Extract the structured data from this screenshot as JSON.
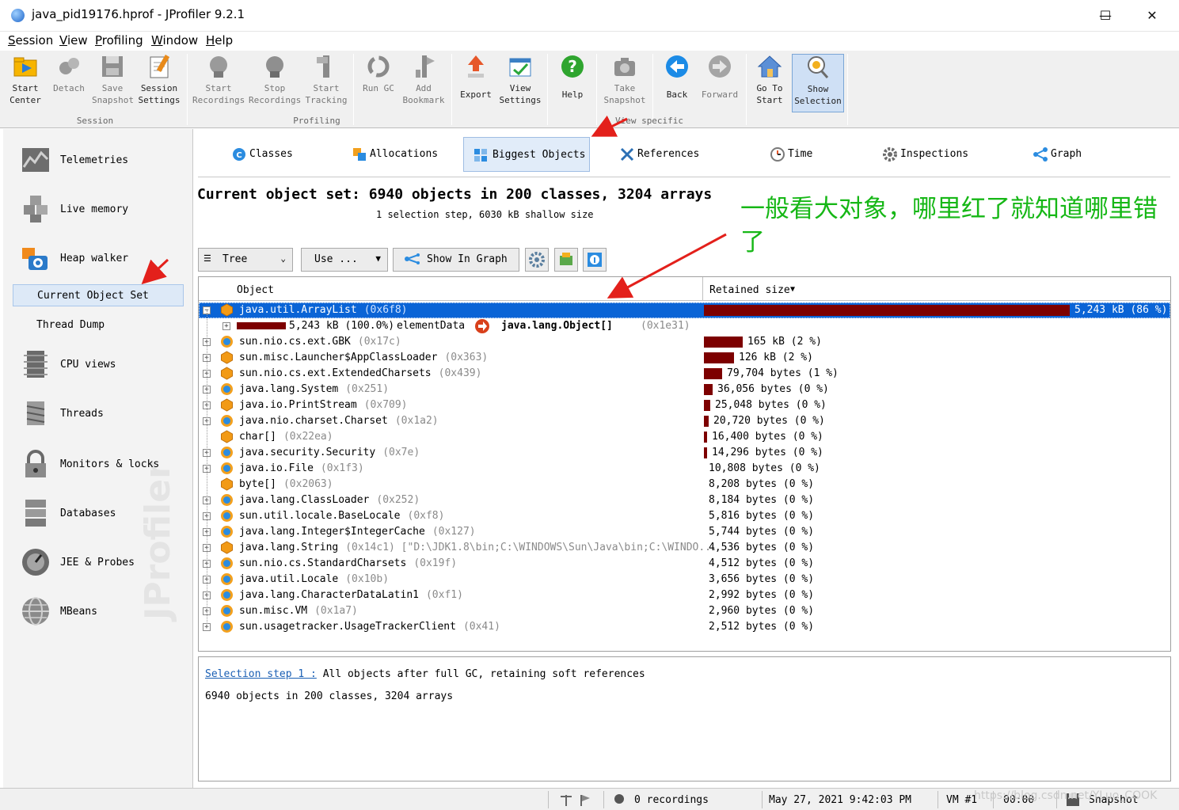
{
  "window": {
    "title": "java_pid19176.hprof - JProfiler 9.2.1",
    "minimize": "—",
    "maximize": "☐",
    "close": "✕"
  },
  "menu": [
    "Session",
    "View",
    "Profiling",
    "Window",
    "Help"
  ],
  "toolbar": {
    "buttons": [
      {
        "label": "Start\nCenter",
        "icon": "folder-start-icon"
      },
      {
        "label": "Detach",
        "icon": "detach-icon"
      },
      {
        "label": "Save\nSnapshot",
        "icon": "save-icon"
      },
      {
        "label": "Session\nSettings",
        "icon": "session-settings-icon"
      },
      {
        "label": "Start\nRecordings",
        "icon": "start-recordings-icon"
      },
      {
        "label": "Stop\nRecordings",
        "icon": "stop-recordings-icon"
      },
      {
        "label": "Start\nTracking",
        "icon": "start-tracking-icon"
      },
      {
        "label": "Run GC",
        "icon": "run-gc-icon"
      },
      {
        "label": "Add\nBookmark",
        "icon": "bookmark-icon"
      },
      {
        "label": "Export",
        "icon": "export-icon"
      },
      {
        "label": "View\nSettings",
        "icon": "view-settings-icon"
      },
      {
        "label": "Help",
        "icon": "help-icon"
      },
      {
        "label": "Take\nSnapshot",
        "icon": "camera-icon"
      },
      {
        "label": "Back",
        "icon": "back-arrow-icon"
      },
      {
        "label": "Forward",
        "icon": "forward-arrow-icon"
      },
      {
        "label": "Go To\nStart",
        "icon": "home-icon"
      },
      {
        "label": "Show\nSelection",
        "icon": "show-selection-icon"
      }
    ],
    "groups": {
      "session": "Session",
      "profiling": "Profiling",
      "view_specific": "View specific"
    }
  },
  "sidebar": {
    "items": [
      {
        "label": "Telemetries",
        "icon": "telemetries-icon"
      },
      {
        "label": "Live memory",
        "icon": "live-memory-icon"
      },
      {
        "label": "Heap walker",
        "icon": "heap-walker-icon"
      },
      {
        "label": "CPU views",
        "icon": "cpu-views-icon"
      },
      {
        "label": "Threads",
        "icon": "threads-icon"
      },
      {
        "label": "Monitors & locks",
        "icon": "monitors-lock-icon"
      },
      {
        "label": "Databases",
        "icon": "databases-icon"
      },
      {
        "label": "JEE & Probes",
        "icon": "jee-probes-icon"
      },
      {
        "label": "MBeans",
        "icon": "mbeans-icon"
      }
    ],
    "sub_items": [
      "Current Object Set",
      "Thread Dump"
    ],
    "watermark": "JProfiler"
  },
  "view_tabs": [
    "Classes",
    "Allocations",
    "Biggest Objects",
    "References",
    "Time",
    "Inspections",
    "Graph"
  ],
  "object_set": {
    "title": "Current object set: 6940 objects in 200 classes, 3204 arrays",
    "subtitle": "1 selection step, 6030 kB shallow size"
  },
  "annotation": "一般看大对象，哪里红了就知道哪里错了",
  "controls": {
    "view_mode": "Tree",
    "use": "Use ...",
    "show_in_graph": "Show In Graph"
  },
  "table": {
    "col_object": "Object",
    "col_retained": "Retained size",
    "sort_arrow": "▼",
    "rows": [
      {
        "name": "java.util.ArrayList",
        "id": "(0x6f8)",
        "retained": "5,243 kB (86 %)",
        "pct": 0.86,
        "icon": "instance-orange-icon",
        "expand": "−"
      },
      {
        "name": "",
        "id": "(0x1e31)",
        "retained": "",
        "pct": 0,
        "icon": "",
        "expand": "+",
        "ref_size": "5,243 kB (100.0%)",
        "ref_field": "elementData",
        "ref_target": "java.lang.Object[]"
      },
      {
        "name": "sun.nio.cs.ext.GBK",
        "id": "(0x17c)",
        "retained": "165 kB (2 %)",
        "pct": 0.023,
        "icon": "class-blue-icon",
        "expand": "+"
      },
      {
        "name": "sun.misc.Launcher$AppClassLoader",
        "id": "(0x363)",
        "retained": "126 kB (2 %)",
        "pct": 0.018,
        "icon": "instance-orange-icon",
        "expand": "+"
      },
      {
        "name": "sun.nio.cs.ext.ExtendedCharsets",
        "id": "(0x439)",
        "retained": "79,704 bytes (1 %)",
        "pct": 0.011,
        "icon": "instance-orange-icon",
        "expand": "+"
      },
      {
        "name": "java.lang.System",
        "id": "(0x251)",
        "retained": "36,056 bytes (0 %)",
        "pct": 0.005,
        "icon": "class-blue-icon",
        "expand": "+"
      },
      {
        "name": "java.io.PrintStream",
        "id": "(0x709)",
        "retained": "25,048 bytes (0 %)",
        "pct": 0.004,
        "icon": "instance-orange-icon",
        "expand": "+"
      },
      {
        "name": "java.nio.charset.Charset",
        "id": "(0x1a2)",
        "retained": "20,720 bytes (0 %)",
        "pct": 0.003,
        "icon": "class-blue-icon",
        "expand": "+"
      },
      {
        "name": "char[]",
        "id": "(0x22ea)",
        "retained": "16,400 bytes (0 %)",
        "pct": 0.002,
        "icon": "instance-orange-icon",
        "expand": ""
      },
      {
        "name": "java.security.Security",
        "id": "(0x7e)",
        "retained": "14,296 bytes (0 %)",
        "pct": 0.002,
        "icon": "class-blue-icon",
        "expand": "+"
      },
      {
        "name": "java.io.File",
        "id": "(0x1f3)",
        "retained": "10,808 bytes (0 %)",
        "pct": 0,
        "icon": "class-blue-icon",
        "expand": "+"
      },
      {
        "name": "byte[]",
        "id": "(0x2063)",
        "retained": "8,208 bytes (0 %)",
        "pct": 0,
        "icon": "instance-orange-icon",
        "expand": ""
      },
      {
        "name": "java.lang.ClassLoader",
        "id": "(0x252)",
        "retained": "8,184 bytes (0 %)",
        "pct": 0,
        "icon": "class-blue-icon",
        "expand": "+"
      },
      {
        "name": "sun.util.locale.BaseLocale",
        "id": "(0xf8)",
        "retained": "5,816 bytes (0 %)",
        "pct": 0,
        "icon": "class-blue-icon",
        "expand": "+"
      },
      {
        "name": "java.lang.Integer$IntegerCache",
        "id": "(0x127)",
        "retained": "5,744 bytes (0 %)",
        "pct": 0,
        "icon": "class-blue-icon",
        "expand": "+"
      },
      {
        "name": "java.lang.String",
        "id": "(0x14c1) [\"D:\\JDK1.8\\bin;C:\\WINDOWS\\Sun\\Java\\bin;C:\\WINDO...",
        "retained": "4,536 bytes (0 %)",
        "pct": 0,
        "icon": "instance-orange-icon",
        "expand": "+"
      },
      {
        "name": "sun.nio.cs.StandardCharsets",
        "id": "(0x19f)",
        "retained": "4,512 bytes (0 %)",
        "pct": 0,
        "icon": "class-blue-icon",
        "expand": "+"
      },
      {
        "name": "java.util.Locale",
        "id": "(0x10b)",
        "retained": "3,656 bytes (0 %)",
        "pct": 0,
        "icon": "class-blue-icon",
        "expand": "+"
      },
      {
        "name": "java.lang.CharacterDataLatin1",
        "id": "(0xf1)",
        "retained": "2,992 bytes (0 %)",
        "pct": 0,
        "icon": "class-blue-icon",
        "expand": "+"
      },
      {
        "name": "sun.misc.VM",
        "id": "(0x1a7)",
        "retained": "2,960 bytes (0 %)",
        "pct": 0,
        "icon": "class-blue-icon",
        "expand": "+"
      },
      {
        "name": "sun.usagetracker.UsageTrackerClient",
        "id": "(0x41)",
        "retained": "2,512 bytes (0 %)",
        "pct": 0,
        "icon": "class-blue-icon",
        "expand": "+"
      }
    ]
  },
  "detail": {
    "step_link": "Selection step 1 :",
    "step_text": "All objects after full GC, retaining soft references",
    "summary": "6940 objects in 200 classes, 3204 arrays"
  },
  "status": {
    "recordings": "0 recordings",
    "datetime": "May 27, 2021 9:42:03 PM",
    "vm": "VM #1",
    "elapsed": "00:00",
    "snapshot": "Snapshot",
    "watermark": "https://blog.csdn.net/YLuo_COOK"
  },
  "colors": {
    "selection": "#0a64d6",
    "retained_bar": "#7d0000",
    "annotation": "#16b716",
    "arrow": "#e3201b"
  }
}
